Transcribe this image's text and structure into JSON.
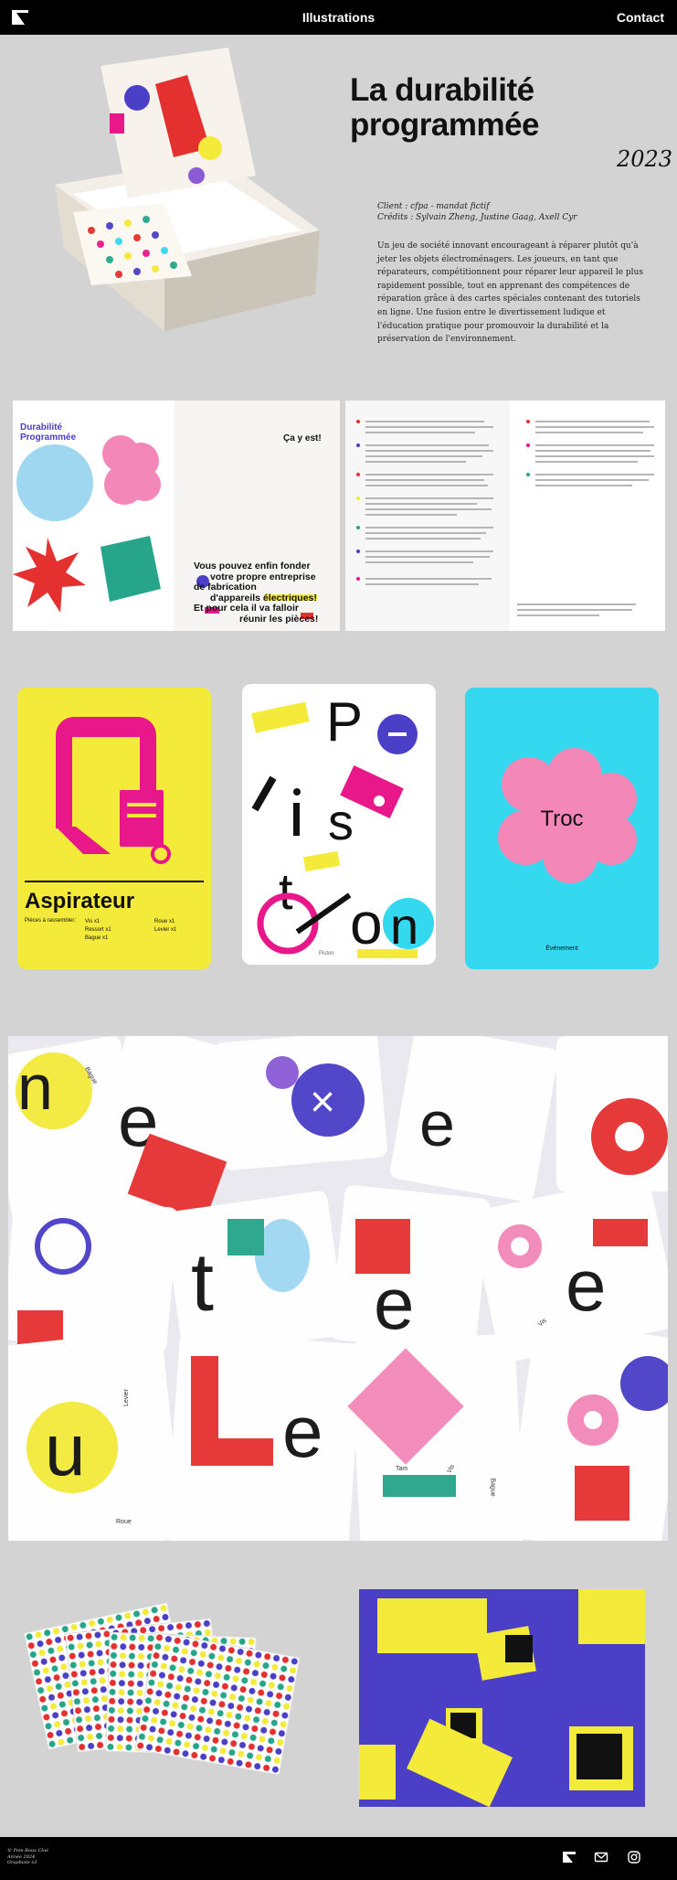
{
  "nav": {
    "title": "Illustrations",
    "contact": "Contact"
  },
  "project": {
    "title_line1": "La durabilité",
    "title_line2": "programmée",
    "year": "2023",
    "client": "Client : cfpa - mandat fictif",
    "credits": "Crédits : Sylvain Zheng, Justine Gaag, Axell Cyr",
    "description": "Un jeu de société innovant encourageant à réparer plutôt qu'à jeter les objets électroménagers. Les joueurs, en tant que réparateurs, compétitionnent pour réparer leur appareil le plus rapidement possible, tout en apprenant des compétences de réparation grâce à des cartes spéciales contenant des tutoriels en ligne. Une fusion entre le divertissement ludique et l'éducation pratique pour promouvoir la durabilité et la préservation de l'environnement."
  },
  "booklet": {
    "cover_title": "Durabilité\nProgrammée",
    "page_heading": "Ça y est!",
    "page_text_1": "Vous pouvez enfin fonder",
    "page_text_2": "votre propre entreprise",
    "page_text_3": "de fabrication",
    "page_text_4": "d'appareils électriques!",
    "page_text_5": "Et pour cela il va falloir",
    "page_text_6": "réunir les pièces!"
  },
  "cards": {
    "card1": {
      "name": "Aspirateur",
      "label": "Pièces à rassembler:",
      "col1_a": "Vis x1",
      "col1_b": "Ressort x1",
      "col1_c": "Bague x1",
      "col2_a": "Roue x1",
      "col2_b": "Levier x1"
    },
    "card2": {
      "name": "Piston"
    },
    "card3": {
      "title": "Troc",
      "type": "Événement"
    }
  },
  "closeup_words": [
    "Vis",
    "Bague",
    "Levier",
    "Roue",
    "Tam",
    "Bague",
    "Vis"
  ],
  "footer": {
    "credit_1": "© Pom-Roux Cloé",
    "credit_2": "Année 2024",
    "credit_3": "Graphiste s3"
  },
  "colors": {
    "background": "#d3d3d3",
    "nav_bg": "#000000",
    "yellow": "#f4ea3a",
    "magenta": "#e8178a",
    "cyan": "#34d8ef",
    "blue_purple": "#4a3fc6",
    "green": "#26a58a",
    "red": "#e53030",
    "pink": "#f287b8"
  },
  "icons": [
    "logo-icon",
    "mail-icon",
    "instagram-icon"
  ]
}
